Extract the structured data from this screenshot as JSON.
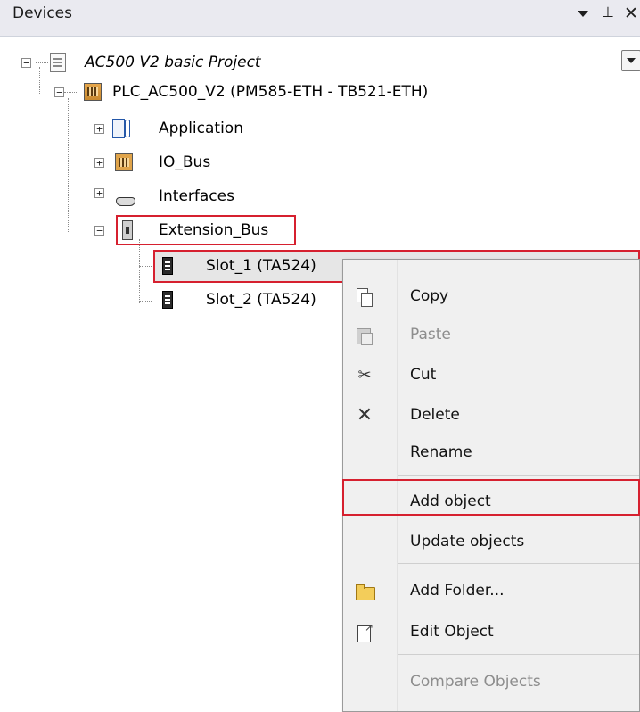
{
  "panel": {
    "title": "Devices"
  },
  "tree": {
    "project": "AC500 V2 basic Project",
    "plc": "PLC_AC500_V2 (PM585-ETH - TB521-ETH)",
    "application": "Application",
    "io_bus": "IO_Bus",
    "interfaces": "Interfaces",
    "extension_bus": "Extension_Bus",
    "slot1": "Slot_1 (TA524)",
    "slot2": "Slot_2 (TA524)"
  },
  "context_menu": {
    "copy": "Copy",
    "paste": "Paste",
    "cut": "Cut",
    "delete": "Delete",
    "rename": "Rename",
    "add_object": "Add object",
    "update_objects": "Update objects",
    "add_folder": "Add Folder...",
    "edit_object": "Edit Object",
    "compare_objects": "Compare Objects"
  },
  "colors": {
    "highlight": "#d6202f",
    "header_bg": "#eaeaf0",
    "menu_bg": "#f0f0f0"
  },
  "icons": [
    "project-icon",
    "plc-icon",
    "application-icon",
    "io-bus-icon",
    "interfaces-icon",
    "extension-bus-icon",
    "slot-icon",
    "copy-icon",
    "paste-icon",
    "cut-icon",
    "delete-icon",
    "folder-icon",
    "edit-object-icon"
  ]
}
